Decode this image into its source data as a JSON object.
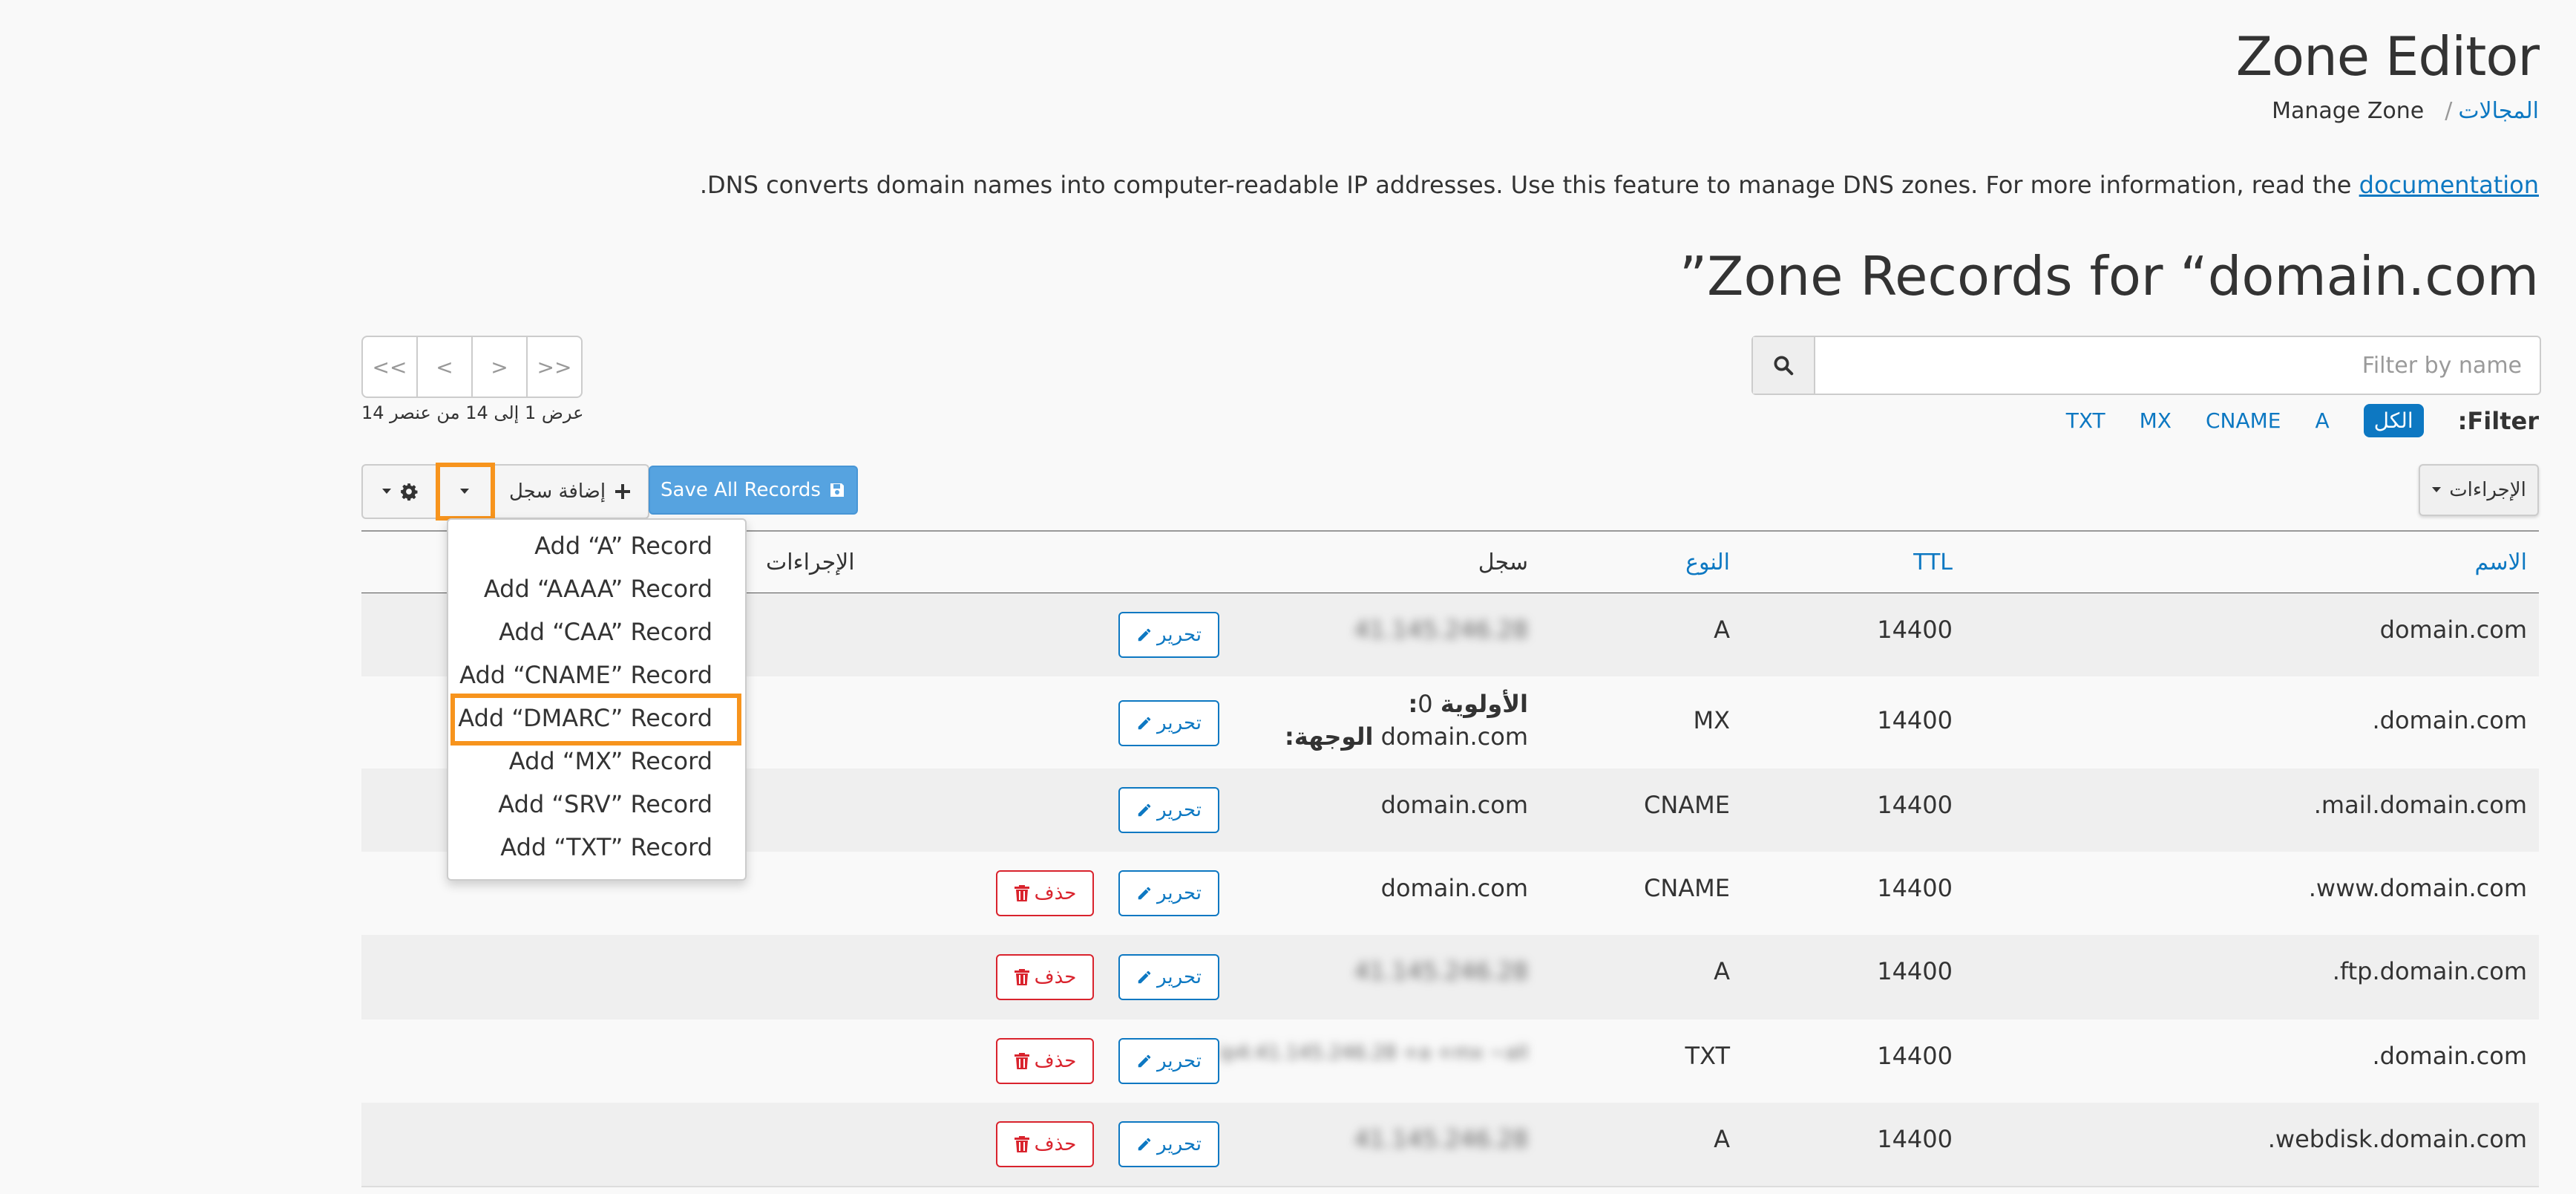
{
  "header": {
    "title": "Zone Editor",
    "breadcrumb_root": "المجالات",
    "breadcrumb_sep": "/",
    "breadcrumb_current": "Manage Zone",
    "description": ".DNS converts domain names into computer-readable IP addresses. Use this feature to manage DNS zones. For more information, read the",
    "description_link": "documentation",
    "zone_heading": "”Zone Records for “domain.com"
  },
  "pager": {
    "first": "<<",
    "prev": "<",
    "next": ">",
    "last": ">>",
    "showing": "عرض 1 إلى 14 من عنصر 14"
  },
  "filter": {
    "placeholder": "Filter by name",
    "label": ":Filter",
    "types": [
      "الكل",
      "A",
      "CNAME",
      "MX",
      "TXT"
    ],
    "active": "الكل"
  },
  "toolbar": {
    "save_all": "Save All Records",
    "add_record": "إضافة سجل",
    "actions": "الإجراءات"
  },
  "table": {
    "headers": {
      "name": "الاسم",
      "ttl": "TTL",
      "type": "النوع",
      "record": "سجل",
      "actions": "الإجراءات"
    },
    "edit_label": "تحرير",
    "delete_label": "حذف",
    "rows": [
      {
        "name": "domain.com",
        "ttl": "14400",
        "type": "A",
        "record": "41.145.246.28"
      },
      {
        "name": ".domain.com",
        "ttl": "14400",
        "type": "MX",
        "priority_label": ":الأولوية",
        "priority": "0",
        "dest_label": ":الوجهة",
        "dest": "domain.com"
      },
      {
        "name": ".mail.domain.com",
        "ttl": "14400",
        "type": "CNAME",
        "record": "domain.com"
      },
      {
        "name": ".www.domain.com",
        "ttl": "14400",
        "type": "CNAME",
        "record": "domain.com"
      },
      {
        "name": ".ftp.domain.com",
        "ttl": "14400",
        "type": "A",
        "record": "41.145.246.28"
      },
      {
        "name": ".domain.com",
        "ttl": "14400",
        "type": "TXT",
        "record": "v=spf1 ip4:41.145.246.28 +a +mx ~all"
      },
      {
        "name": ".webdisk.domain.com",
        "ttl": "14400",
        "type": "A",
        "record": "41.145.246.28"
      }
    ]
  },
  "add_menu": {
    "items": [
      "Add “A” Record",
      "Add “AAAA” Record",
      "Add “CAA” Record",
      "Add “CNAME” Record",
      "Add “DMARC” Record",
      "Add “MX” Record",
      "Add “SRV” Record",
      "Add “TXT” Record"
    ],
    "highlighted": "Add “DMARC” Record"
  },
  "colors": {
    "accent": "#0d78c2",
    "save_button": "#56a3e0",
    "highlight": "#f7941d",
    "danger": "#d9232d"
  }
}
